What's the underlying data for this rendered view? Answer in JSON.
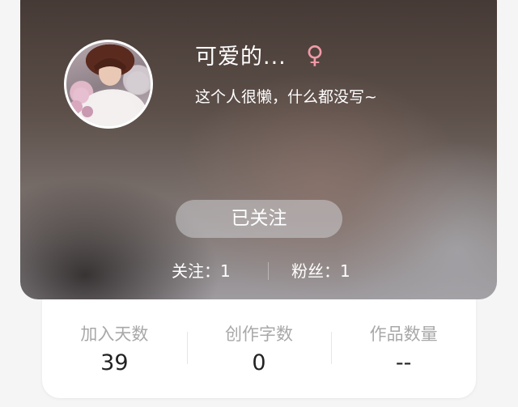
{
  "profile": {
    "name": "可爱的...",
    "gender_symbol": "♀",
    "signature": "这个人很懒，什么都没写~",
    "follow_button_label": "已关注",
    "following_text": "关注：1",
    "followers_text": "粉丝：1"
  },
  "stats": [
    {
      "label": "加入天数",
      "value": "39"
    },
    {
      "label": "创作字数",
      "value": "0"
    },
    {
      "label": "作品数量",
      "value": "--"
    }
  ],
  "colors": {
    "gender_accent": "#f19aa8",
    "card_background": "#ffffff",
    "page_background": "#f5f5f5"
  }
}
